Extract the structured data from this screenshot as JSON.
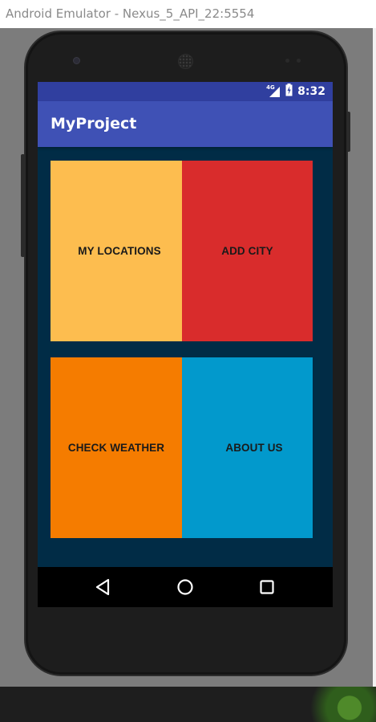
{
  "window": {
    "title": "Android Emulator - Nexus_5_API_22:5554"
  },
  "status_bar": {
    "network": "4G",
    "time": "8:32",
    "icons": [
      "signal-icon",
      "battery-icon"
    ]
  },
  "app_bar": {
    "title": "MyProject"
  },
  "tiles": [
    {
      "label": "MY LOCATIONS",
      "color": "#fdbd4f"
    },
    {
      "label": "ADD CITY",
      "color": "#d92c2c"
    },
    {
      "label": "CHECK WEATHER",
      "color": "#f57c00"
    },
    {
      "label": "ABOUT US",
      "color": "#0299cc"
    }
  ],
  "navigation": {
    "buttons": [
      "back-icon",
      "home-icon",
      "recents-icon"
    ]
  },
  "colors": {
    "status_bar": "#303f9f",
    "app_bar": "#3f51b5",
    "screen_background": "#012c46"
  }
}
